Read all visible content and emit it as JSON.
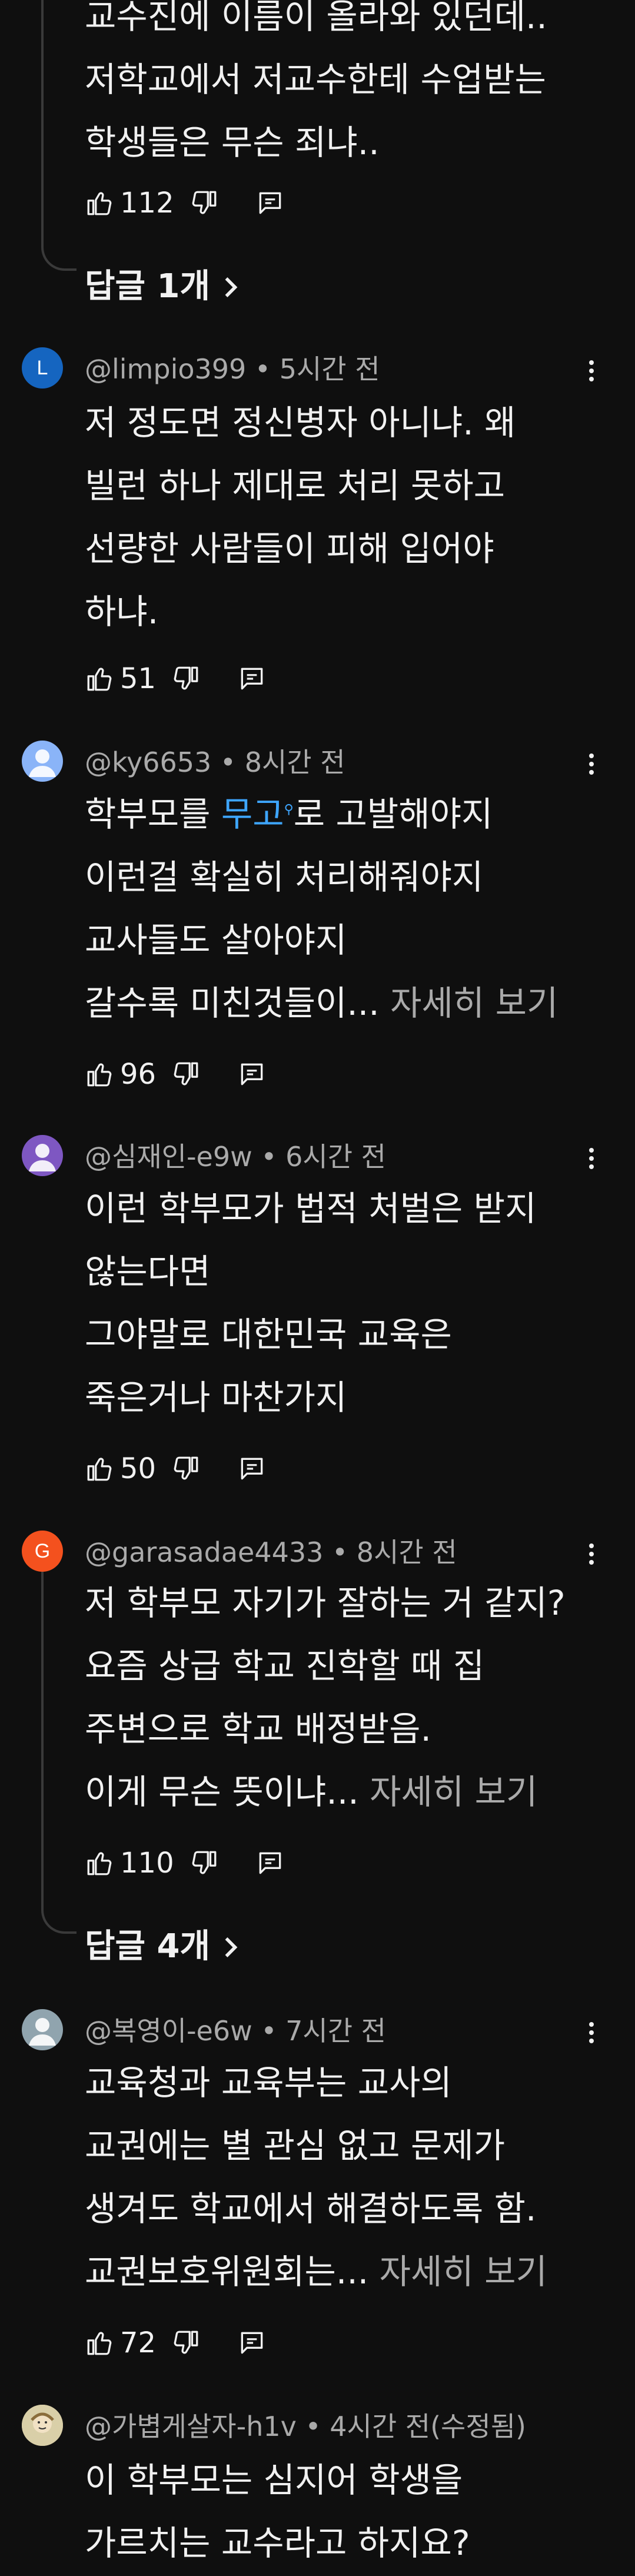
{
  "comments": [
    {
      "lines": [
        "교수진에 이름이 올라와 있던데..",
        "저학교에서 저교수한테 수업받는",
        "학생들은 무슨 죄냐.."
      ],
      "likes": "112",
      "replies": "답글 1개"
    },
    {
      "avatar_letter": "L",
      "avatar_color": "#1565c0",
      "author": "@limpio399",
      "time": "5시간 전",
      "lines": [
        "저 정도면 정신병자 아니냐. 왜",
        "빌런 하나 제대로 처리 못하고",
        "선량한 사람들이 피해 입어야",
        "하냐."
      ],
      "likes": "51"
    },
    {
      "avatar_color": "#8ab4f8",
      "author": "@ky6653",
      "time": "8시간 전",
      "line1_prefix": "학부모를 ",
      "line1_link": "무고",
      "line1_suffix": "로 고발해야지",
      "lines": [
        "이런걸 확실히 처리해줘야지",
        "교사들도 살아야지"
      ],
      "last_line": "갈수록 미친것들이...",
      "more": "자세히 보기",
      "likes": "96"
    },
    {
      "avatar_color": "#7e57c2",
      "author": "@심재인-e9w",
      "time": "6시간 전",
      "lines": [
        "이런 학부모가 법적 처벌은 받지",
        "않는다면",
        "그야말로 대한민국 교육은",
        "죽은거나 마찬가지"
      ],
      "likes": "50"
    },
    {
      "avatar_letter": "G",
      "avatar_color": "#f4511e",
      "author": "@garasadae4433",
      "time": "8시간 전",
      "lines": [
        "저 학부모 자기가 잘하는 거 같지?",
        "요즘 상급 학교 진학할 때 집",
        "주변으로 학교 배정받음."
      ],
      "last_line": "이게 무슨 뜻이냐...",
      "more": "자세히 보기",
      "likes": "110",
      "replies": "답글 4개"
    },
    {
      "avatar_color": "#90a4ae",
      "author": "@복영이-e6w",
      "time": "7시간 전",
      "lines": [
        "교육청과 교육부는 교사의",
        "교권에는 별 관심 없고 문제가",
        "생겨도 학교에서 해결하도록 함."
      ],
      "last_line": "교권보호위원회는...",
      "more": "자세히 보기",
      "likes": "72"
    },
    {
      "avatar_color": "#c8b88a",
      "author": "@가볍게살자-h1v",
      "time": "4시간 전(수정됨)",
      "lines": [
        "이 학부모는 심지어 학생을",
        "가르치는 교수라고 하지요?"
      ]
    }
  ]
}
